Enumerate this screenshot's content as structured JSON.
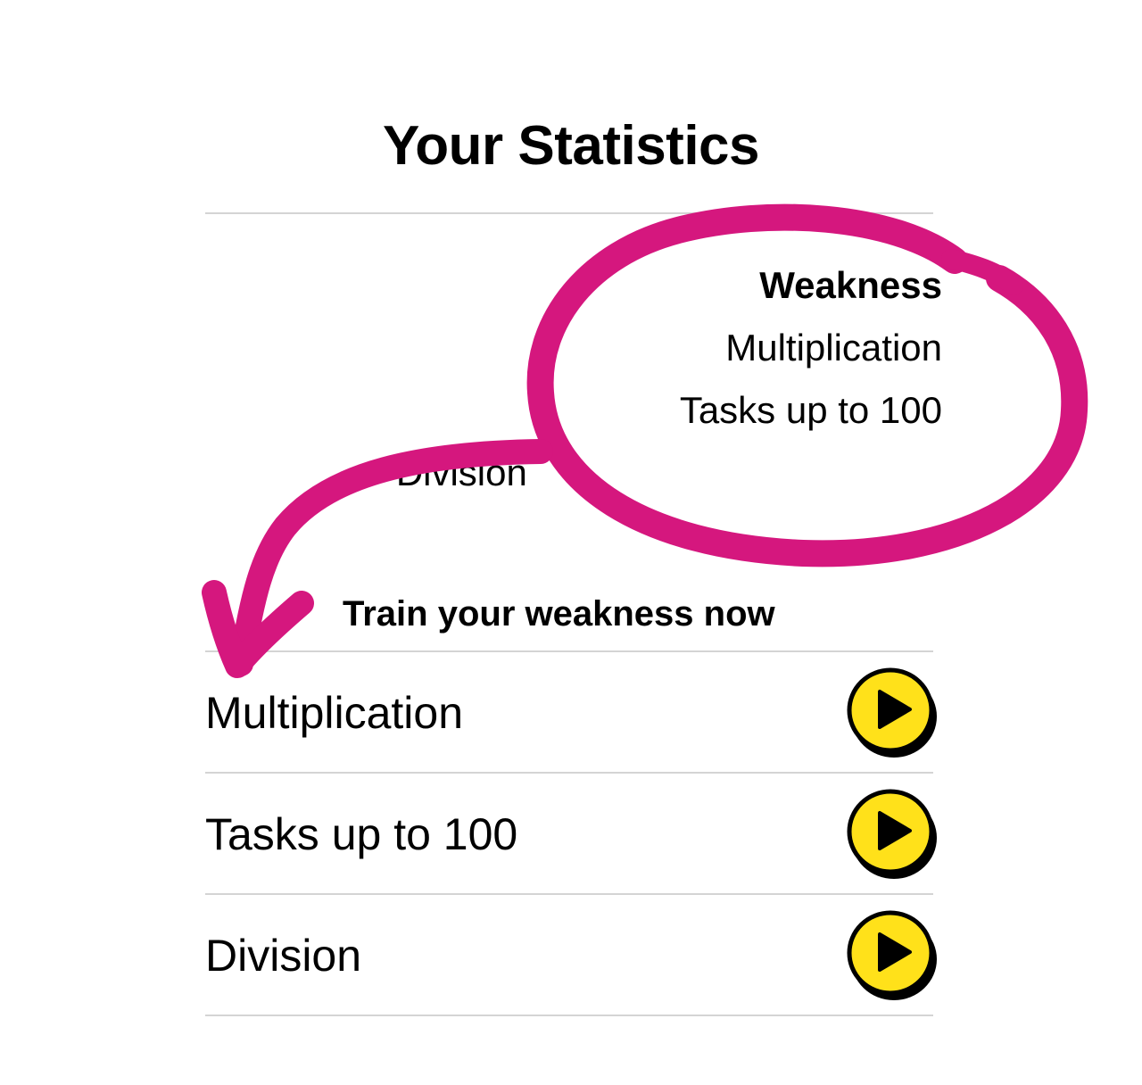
{
  "page": {
    "title": "Your Statistics"
  },
  "weakness": {
    "heading": "Weakness",
    "items": [
      "Multiplication",
      "Tasks up to 100",
      "Division"
    ]
  },
  "train": {
    "heading": "Train your weakness now",
    "rows": [
      {
        "label": "Multiplication",
        "icon": "play-icon"
      },
      {
        "label": "Tasks up to 100",
        "icon": "play-icon"
      },
      {
        "label": "Division",
        "icon": "play-icon"
      }
    ]
  },
  "colors": {
    "annotation": "#d5177e",
    "play_button": "#ffe11a",
    "divider": "#d4d4d4"
  }
}
